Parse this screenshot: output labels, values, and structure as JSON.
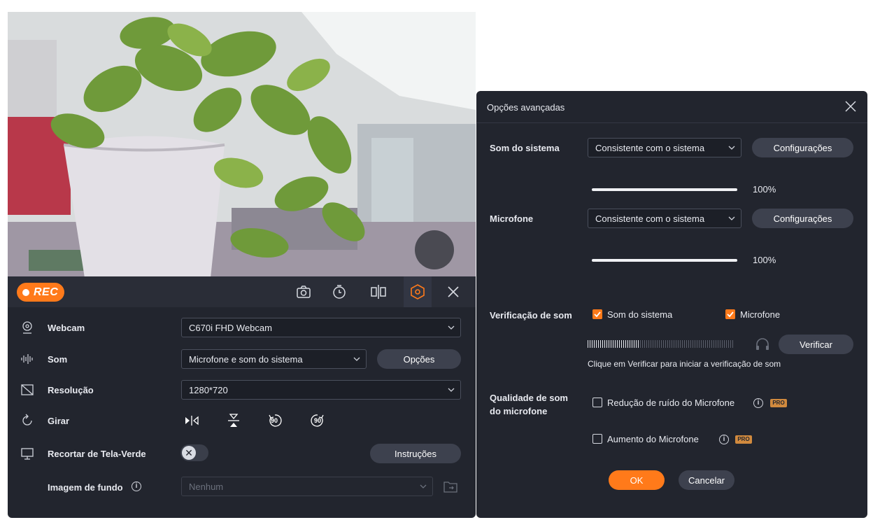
{
  "toolbar": {
    "rec_label": "REC",
    "icons": [
      "camera-icon",
      "timer-icon",
      "mirror-icon",
      "settings-hex-icon",
      "close-icon"
    ]
  },
  "panel": {
    "webcam": {
      "label": "Webcam",
      "value": "C670i FHD Webcam"
    },
    "sound": {
      "label": "Som",
      "value": "Microfone e som do sistema",
      "options_button": "Opções"
    },
    "resolution": {
      "label": "Resolução",
      "value": "1280*720"
    },
    "rotate": {
      "label": "Girar",
      "left_90": "90",
      "right_90": "90"
    },
    "greenscreen": {
      "label": "Recortar de Tela-Verde",
      "instructions_button": "Instruções"
    },
    "background": {
      "label": "Imagem de fundo",
      "info": "i",
      "value": "Nenhum"
    }
  },
  "dialog": {
    "title": "Opções avançadas",
    "system_sound": {
      "label": "Som do sistema",
      "value": "Consistente com o sistema",
      "config_button": "Configurações",
      "volume_text": "100%",
      "volume": 1.0
    },
    "microphone": {
      "label": "Microfone",
      "value": "Consistente com o sistema",
      "config_button": "Configurações",
      "volume_text": "100%",
      "volume": 1.0
    },
    "sound_check": {
      "label": "Verificação de som",
      "system_checkbox": "Som do sistema",
      "mic_checkbox": "Microfone",
      "verify_button": "Verificar",
      "hint": "Clique em Verificar para iniciar a verificação de som",
      "level": 0.35
    },
    "mic_quality": {
      "label_line1": "Qualidade de som",
      "label_line2": "do microfone",
      "noise_reduction": "Redução de ruído do Microfone",
      "boost": "Aumento do Microfone",
      "info": "i",
      "pro_badge": "PRO"
    },
    "ok_button": "OK",
    "cancel_button": "Cancelar"
  },
  "colors": {
    "accent": "#ff7a1a",
    "panel_bg": "#22252e",
    "button_bg": "#3d414e"
  }
}
